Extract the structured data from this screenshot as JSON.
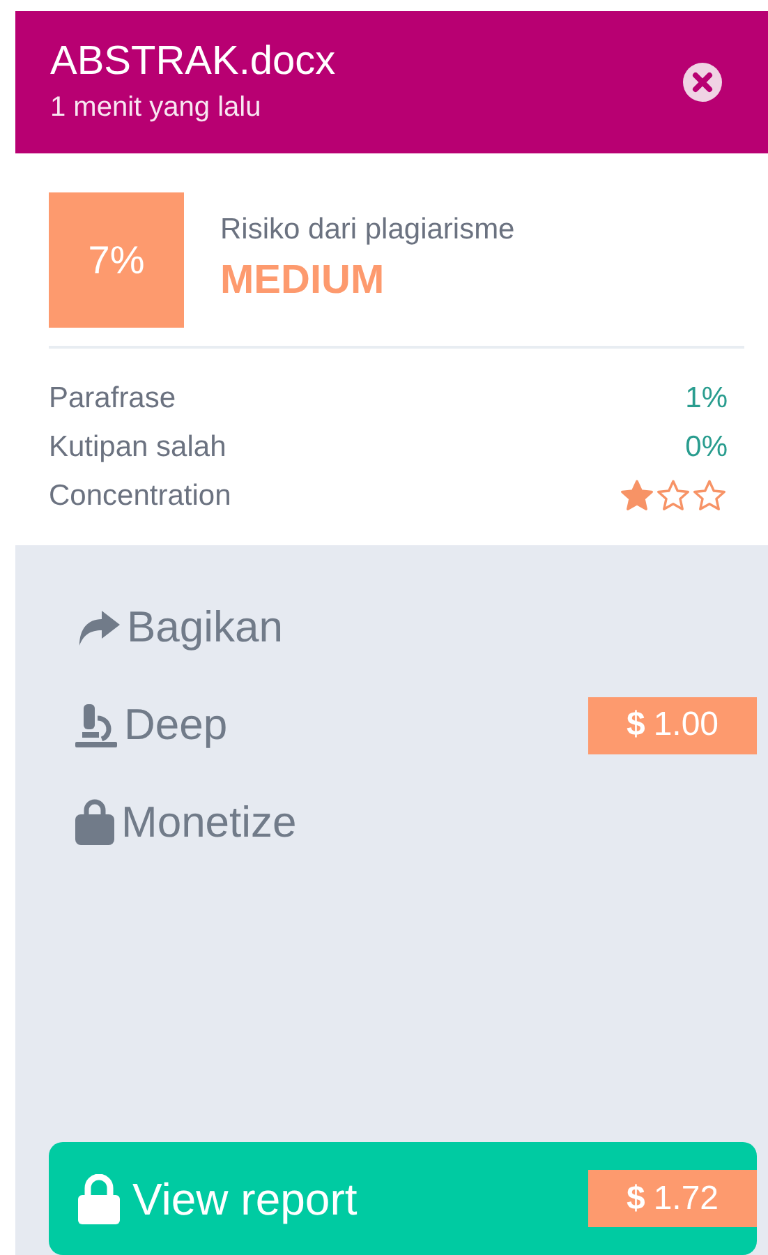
{
  "header": {
    "title": "ABSTRAK.docx",
    "subtitle": "1 menit yang lalu"
  },
  "score": {
    "value": "7%",
    "label": "Risiko dari plagiarisme",
    "risk": "MEDIUM"
  },
  "metrics": [
    {
      "kind": "percent",
      "label": "Parafrase",
      "value": "1%"
    },
    {
      "kind": "percent",
      "label": "Kutipan salah",
      "value": "0%"
    },
    {
      "kind": "stars",
      "label": "Concentration",
      "stars": 1
    }
  ],
  "actions": [
    {
      "kind": "share",
      "label": "Bagikan"
    },
    {
      "kind": "microscope",
      "label": "Deep",
      "price": {
        "currency": "$",
        "amount": "1.00"
      }
    },
    {
      "kind": "bag",
      "label": "Monetize"
    }
  ],
  "report_button": {
    "label": "View report",
    "price": {
      "currency": "$",
      "amount": "1.72"
    }
  }
}
